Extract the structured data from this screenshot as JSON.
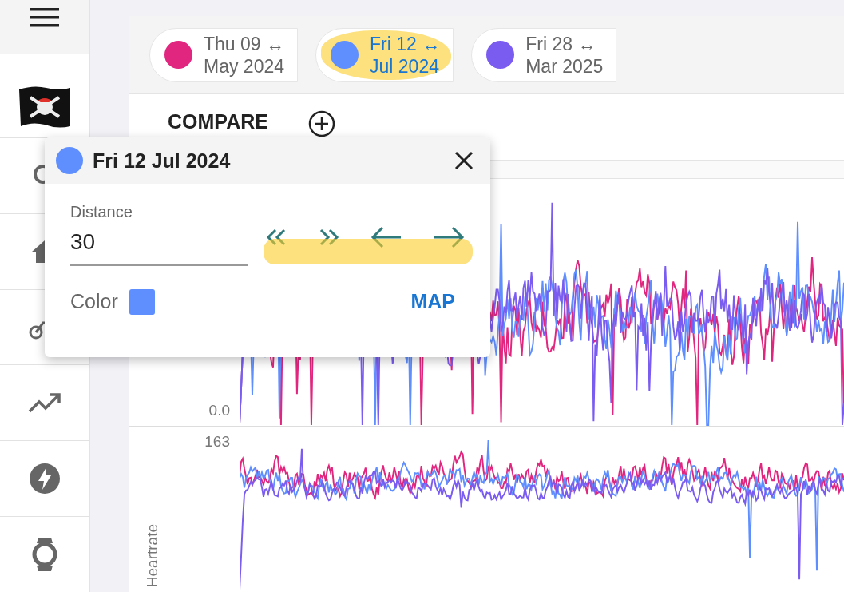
{
  "compare_chips": [
    {
      "line_1": "Thu 09",
      "arrow": "↔",
      "line_2": "May 2024",
      "color": "#e0267f",
      "selected": false,
      "highlighted": false
    },
    {
      "line_1": "Fri 12",
      "arrow": "↔",
      "line_2": "Jul 2024",
      "color": "#5f8fff",
      "selected": true,
      "highlighted": true
    },
    {
      "line_1": "Fri 28",
      "arrow": "↔",
      "line_2": "Mar 2025",
      "color": "#7b5cf0",
      "selected": false,
      "highlighted": false
    }
  ],
  "compare_label": "COMPARE",
  "popup": {
    "color": "#5f8fff",
    "title": "Fri 12 Jul 2024",
    "distance_label": "Distance",
    "distance_value": "30",
    "nav_highlighted": true,
    "color_label": "Color",
    "map_button": "MAP"
  },
  "charts": [
    {
      "y_tick": "0.0"
    },
    {
      "y_tick": "163",
      "y_axis_label": "Heartrate"
    }
  ]
}
